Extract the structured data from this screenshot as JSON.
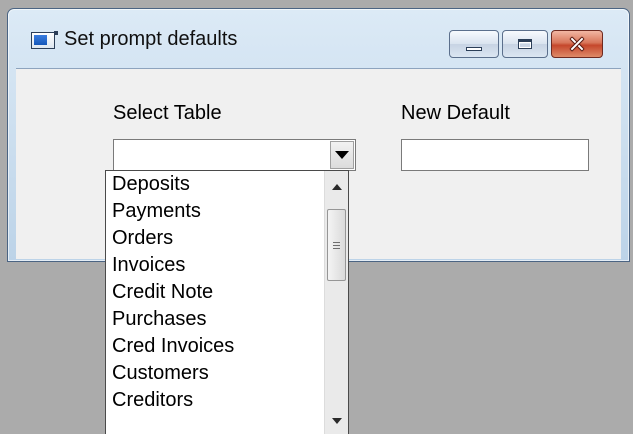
{
  "window": {
    "title": "Set prompt defaults",
    "icon": "app-window-icon",
    "controls": [
      "minimize-icon",
      "maximize-icon",
      "close-icon"
    ]
  },
  "form": {
    "select_table_label": "Select Table",
    "select_table_value": "",
    "new_default_label": "New Default",
    "new_default_value": ""
  },
  "dropdown": {
    "items": [
      "Deposits",
      "Payments",
      "Orders",
      "Invoices",
      "Credit Note",
      "Purchases",
      "Cred Invoices",
      "Customers",
      "Creditors"
    ]
  },
  "colors": {
    "desktop_background": "#ababab",
    "dialog_background": "#f0f0f0",
    "close_button": "#c5472c"
  }
}
